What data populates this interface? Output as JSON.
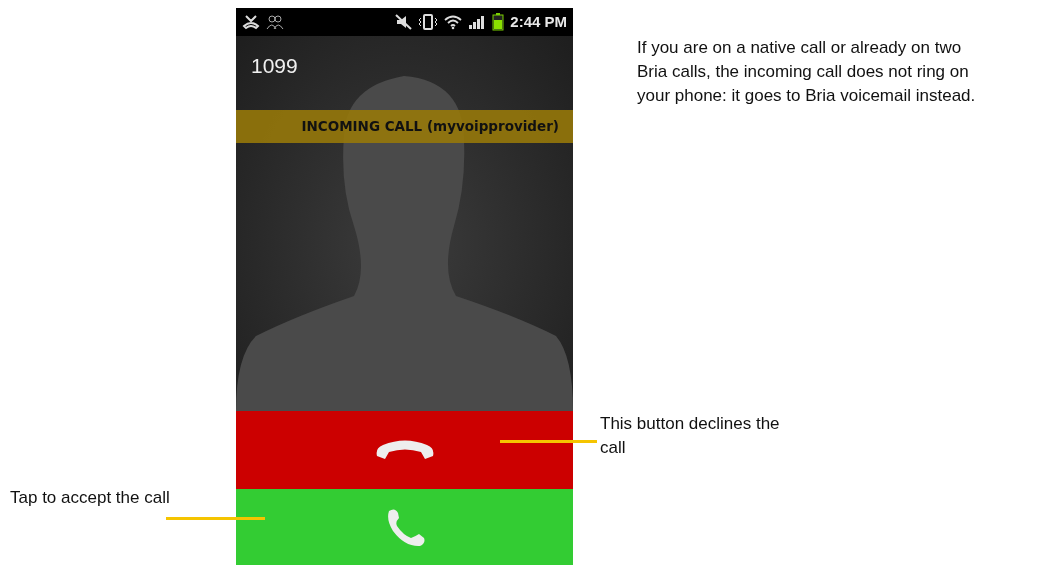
{
  "phone": {
    "status_bar": {
      "time": "2:44 PM"
    },
    "caller": "1099",
    "banner": "INCOMING CALL (myvoipprovider)",
    "buttons": [
      {
        "kind": "decline"
      },
      {
        "kind": "accept"
      }
    ]
  },
  "notes": [
    {
      "kind": "side",
      "text": "If you are on a native call or already on two Bria calls, the incoming call does not ring on your phone: it goes to Bria voicemail instead."
    },
    {
      "kind": "decline",
      "text": "This button declines the call"
    },
    {
      "kind": "accept",
      "text": "Tap to accept the call"
    }
  ]
}
